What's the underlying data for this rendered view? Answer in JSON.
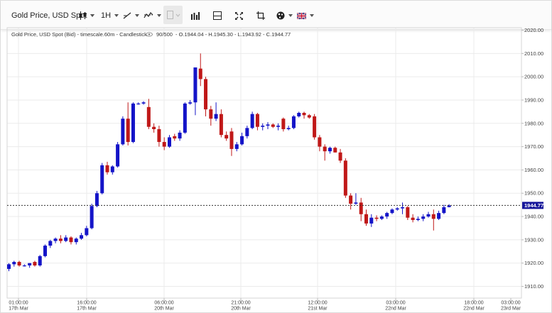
{
  "toolbar": {
    "instrument": "Gold Price, USD Spot",
    "timeframe": "1H",
    "icons": [
      "candlestick-chart-icon",
      "draw-line-icon",
      "indicators-icon",
      "drawing-disabled-icon",
      "volume-bars-icon",
      "split-panel-icon",
      "fullscreen-icon",
      "crop-icon",
      "theme-icon",
      "uk-flag-icon"
    ]
  },
  "chart_data": {
    "type": "candlestick",
    "title": "Gold Price, USD Spot (Bid) - timescale.60m - Candlestick",
    "counter": "90/500",
    "ohlc_label": "- O.1944.04 - H.1945.30 - L.1943.92 - C.1944.77",
    "current_price_label": "1944.77",
    "current_price": 1944.77,
    "ylim": [
      1905,
      2022
    ],
    "y_ticks": [
      "2020.00",
      "2010.00",
      "2000.00",
      "1990.00",
      "1980.00",
      "1970.00",
      "1960.00",
      "1950.00",
      "1940.00",
      "1930.00",
      "1920.00",
      "1910.00"
    ],
    "x_ticks": [
      {
        "time": "01:00:00",
        "date": "17th Mar"
      },
      {
        "time": "16:00:00",
        "date": "17th Mar"
      },
      {
        "time": "06:00:00",
        "date": "20th Mar"
      },
      {
        "time": "21:00:00",
        "date": "20th Mar"
      },
      {
        "time": "12:00:00",
        "date": "21st Mar"
      },
      {
        "time": "03:00:00",
        "date": "22nd Mar"
      },
      {
        "time": "18:00:00",
        "date": "22nd Mar"
      },
      {
        "time": "03:00:00",
        "date": "23rd Mar"
      }
    ],
    "colors": {
      "up": "#1414c8",
      "down": "#c01818",
      "grid": "#ebebeb",
      "price_line": "#333333"
    },
    "candles": [
      {
        "o": 1917.5,
        "h": 1920,
        "l": 1916.5,
        "c": 1919.5
      },
      {
        "o": 1919.5,
        "h": 1921,
        "l": 1918.5,
        "c": 1920.5
      },
      {
        "o": 1920.5,
        "h": 1921,
        "l": 1918.5,
        "c": 1919
      },
      {
        "o": 1919,
        "h": 1919.5,
        "l": 1918.5,
        "c": 1919
      },
      {
        "o": 1919,
        "h": 1920,
        "l": 1918,
        "c": 1920
      },
      {
        "o": 1920.5,
        "h": 1921,
        "l": 1918.5,
        "c": 1919
      },
      {
        "o": 1919,
        "h": 1923.5,
        "l": 1918.5,
        "c": 1923
      },
      {
        "o": 1923,
        "h": 1928,
        "l": 1922.5,
        "c": 1927.5
      },
      {
        "o": 1927.5,
        "h": 1930,
        "l": 1926.5,
        "c": 1929.5
      },
      {
        "o": 1929.5,
        "h": 1931,
        "l": 1928.5,
        "c": 1930.5
      },
      {
        "o": 1930.5,
        "h": 1932,
        "l": 1928.5,
        "c": 1929.5
      },
      {
        "o": 1929.5,
        "h": 1932,
        "l": 1929,
        "c": 1931
      },
      {
        "o": 1931,
        "h": 1931.5,
        "l": 1928,
        "c": 1929
      },
      {
        "o": 1929,
        "h": 1931,
        "l": 1928,
        "c": 1930.5
      },
      {
        "o": 1930.5,
        "h": 1933,
        "l": 1930,
        "c": 1932
      },
      {
        "o": 1932,
        "h": 1936,
        "l": 1931.5,
        "c": 1935
      },
      {
        "o": 1935,
        "h": 1945.5,
        "l": 1934.5,
        "c": 1944.5
      },
      {
        "o": 1944.5,
        "h": 1951,
        "l": 1944,
        "c": 1950
      },
      {
        "o": 1950,
        "h": 1963,
        "l": 1949.5,
        "c": 1962
      },
      {
        "o": 1962,
        "h": 1963.5,
        "l": 1958,
        "c": 1959
      },
      {
        "o": 1959,
        "h": 1962,
        "l": 1958,
        "c": 1961.5
      },
      {
        "o": 1961.5,
        "h": 1972,
        "l": 1961,
        "c": 1971
      },
      {
        "o": 1971,
        "h": 1983,
        "l": 1970.5,
        "c": 1982
      },
      {
        "o": 1982,
        "h": 1989,
        "l": 1970.5,
        "c": 1972
      },
      {
        "o": 1972,
        "h": 1989,
        "l": 1971.5,
        "c": 1988.5
      },
      {
        "o": 1988.5,
        "h": 1989,
        "l": 1988,
        "c": 1988.5
      },
      {
        "o": 1988.5,
        "h": 1989.5,
        "l": 1988,
        "c": 1989
      },
      {
        "o": 1987,
        "h": 1990.5,
        "l": 1977.5,
        "c": 1978.5
      },
      {
        "o": 1978.5,
        "h": 1980,
        "l": 1976,
        "c": 1977.5
      },
      {
        "o": 1977.5,
        "h": 1979,
        "l": 1970,
        "c": 1972
      },
      {
        "o": 1972,
        "h": 1974,
        "l": 1968.5,
        "c": 1970
      },
      {
        "o": 1970,
        "h": 1975,
        "l": 1969.5,
        "c": 1974
      },
      {
        "o": 1974.5,
        "h": 1975.5,
        "l": 1972.5,
        "c": 1973.5
      },
      {
        "o": 1973.5,
        "h": 1977,
        "l": 1972.5,
        "c": 1976
      },
      {
        "o": 1976,
        "h": 1989,
        "l": 1975.5,
        "c": 1988.5
      },
      {
        "o": 1988.5,
        "h": 1990,
        "l": 1988,
        "c": 1989
      },
      {
        "o": 1989,
        "h": 2000,
        "l": 1983.5,
        "c": 2004
      },
      {
        "o": 2003.5,
        "h": 2010,
        "l": 1996,
        "c": 1999
      },
      {
        "o": 1999,
        "h": 2000,
        "l": 1983,
        "c": 1986
      },
      {
        "o": 1986,
        "h": 1987.5,
        "l": 1979,
        "c": 1982
      },
      {
        "o": 1982,
        "h": 1989,
        "l": 1981,
        "c": 1984
      },
      {
        "o": 1984,
        "h": 1986,
        "l": 1974,
        "c": 1975
      },
      {
        "o": 1975,
        "h": 1976.5,
        "l": 1972.5,
        "c": 1973.5
      },
      {
        "o": 1976.5,
        "h": 1978,
        "l": 1966,
        "c": 1969
      },
      {
        "o": 1969,
        "h": 1972,
        "l": 1968,
        "c": 1971
      },
      {
        "o": 1971,
        "h": 1976,
        "l": 1970.5,
        "c": 1974.5
      },
      {
        "o": 1974.5,
        "h": 1979,
        "l": 1973.5,
        "c": 1978
      },
      {
        "o": 1978,
        "h": 1985,
        "l": 1977.5,
        "c": 1984
      },
      {
        "o": 1984,
        "h": 1984.5,
        "l": 1977,
        "c": 1978.5
      },
      {
        "o": 1978.5,
        "h": 1980,
        "l": 1977,
        "c": 1979
      },
      {
        "o": 1979,
        "h": 1980.5,
        "l": 1977.5,
        "c": 1979.5
      },
      {
        "o": 1979.5,
        "h": 1980,
        "l": 1978,
        "c": 1978.5
      },
      {
        "o": 1978.5,
        "h": 1980,
        "l": 1977,
        "c": 1979
      },
      {
        "o": 1982,
        "h": 1982.5,
        "l": 1976.5,
        "c": 1977.5
      },
      {
        "o": 1977.5,
        "h": 1979,
        "l": 1977,
        "c": 1978
      },
      {
        "o": 1978,
        "h": 1983.5,
        "l": 1977.5,
        "c": 1983
      },
      {
        "o": 1983,
        "h": 1985,
        "l": 1982.5,
        "c": 1984.5
      },
      {
        "o": 1984.5,
        "h": 1985,
        "l": 1982,
        "c": 1983.5
      },
      {
        "o": 1983.5,
        "h": 1984,
        "l": 1982,
        "c": 1982.5
      },
      {
        "o": 1983,
        "h": 1984,
        "l": 1973,
        "c": 1974
      },
      {
        "o": 1974,
        "h": 1975,
        "l": 1968,
        "c": 1970
      },
      {
        "o": 1970,
        "h": 1971,
        "l": 1964,
        "c": 1968
      },
      {
        "o": 1968,
        "h": 1970,
        "l": 1967,
        "c": 1969.5
      },
      {
        "o": 1969.5,
        "h": 1970,
        "l": 1967.5,
        "c": 1967.5
      },
      {
        "o": 1967.5,
        "h": 1969,
        "l": 1963,
        "c": 1964
      },
      {
        "o": 1964,
        "h": 1965,
        "l": 1948,
        "c": 1949
      },
      {
        "o": 1949,
        "h": 1950,
        "l": 1943,
        "c": 1945.5
      },
      {
        "o": 1945.5,
        "h": 1950,
        "l": 1945,
        "c": 1946
      },
      {
        "o": 1946,
        "h": 1948,
        "l": 1938,
        "c": 1941
      },
      {
        "o": 1941,
        "h": 1943,
        "l": 1936,
        "c": 1937
      },
      {
        "o": 1937,
        "h": 1941,
        "l": 1935.5,
        "c": 1939.5
      },
      {
        "o": 1939.5,
        "h": 1940.5,
        "l": 1938,
        "c": 1939
      },
      {
        "o": 1939,
        "h": 1940.5,
        "l": 1938.5,
        "c": 1940
      },
      {
        "o": 1940,
        "h": 1942,
        "l": 1939,
        "c": 1941.5
      },
      {
        "o": 1941.5,
        "h": 1943.5,
        "l": 1941,
        "c": 1943
      },
      {
        "o": 1943,
        "h": 1944,
        "l": 1942.5,
        "c": 1943.5
      },
      {
        "o": 1943.5,
        "h": 1946,
        "l": 1941,
        "c": 1944
      },
      {
        "o": 1944,
        "h": 1944.5,
        "l": 1938.5,
        "c": 1939.5
      },
      {
        "o": 1939.5,
        "h": 1941,
        "l": 1937.5,
        "c": 1938.5
      },
      {
        "o": 1938.5,
        "h": 1940,
        "l": 1938,
        "c": 1939
      },
      {
        "o": 1939,
        "h": 1941,
        "l": 1938,
        "c": 1940
      },
      {
        "o": 1940,
        "h": 1942,
        "l": 1939.5,
        "c": 1941
      },
      {
        "o": 1941,
        "h": 1943,
        "l": 1934,
        "c": 1939
      },
      {
        "o": 1939,
        "h": 1942.5,
        "l": 1938.5,
        "c": 1941.5
      },
      {
        "o": 1941.5,
        "h": 1945,
        "l": 1941,
        "c": 1944
      },
      {
        "o": 1944.04,
        "h": 1945.3,
        "l": 1943.92,
        "c": 1944.77
      }
    ]
  }
}
